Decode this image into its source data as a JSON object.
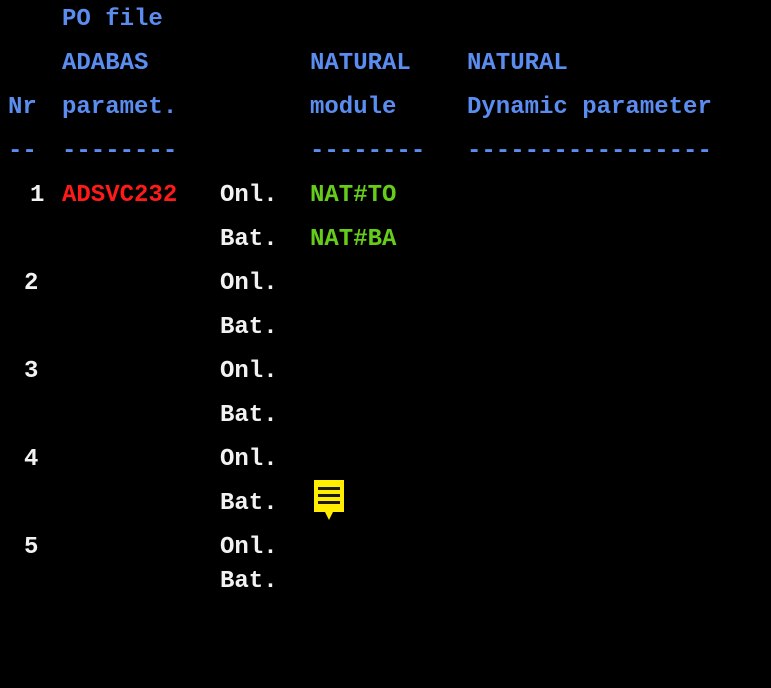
{
  "header": {
    "line1": {
      "po": "PO file"
    },
    "line2": {
      "adabas": "ADABAS",
      "natural1": "NATURAL",
      "natural2": "NATURAL"
    },
    "line3": {
      "nr": "Nr",
      "paramet": "paramet.",
      "module": "module",
      "dynamic": "Dynamic parameter"
    },
    "separator": {
      "a": "--",
      "b": "--------",
      "c": "--------",
      "d": "-----------------"
    }
  },
  "rows": [
    {
      "nr": "1",
      "param": "ADSVC232",
      "onl": "Onl.",
      "bat": "Bat.",
      "onl_module": "NAT#TO",
      "bat_module": "NAT#BA"
    },
    {
      "nr": "2",
      "param": "",
      "onl": "Onl.",
      "bat": "Bat.",
      "onl_module": "",
      "bat_module": ""
    },
    {
      "nr": "3",
      "param": "",
      "onl": "Onl.",
      "bat": "Bat.",
      "onl_module": "",
      "bat_module": ""
    },
    {
      "nr": "4",
      "param": "",
      "onl": "Onl.",
      "bat": "Bat.",
      "onl_module": "",
      "bat_module": ""
    },
    {
      "nr": "5",
      "param": "",
      "onl": "Onl.",
      "bat": "Bat.",
      "onl_module": "",
      "bat_module": ""
    }
  ],
  "colors": {
    "header": "#5b8cf0",
    "text": "#f2f2f2",
    "adabas_param": "#ff1a1a",
    "natural_module": "#66cc1a",
    "note_icon": "#ffee00"
  },
  "icons": {
    "note": "note-icon"
  }
}
